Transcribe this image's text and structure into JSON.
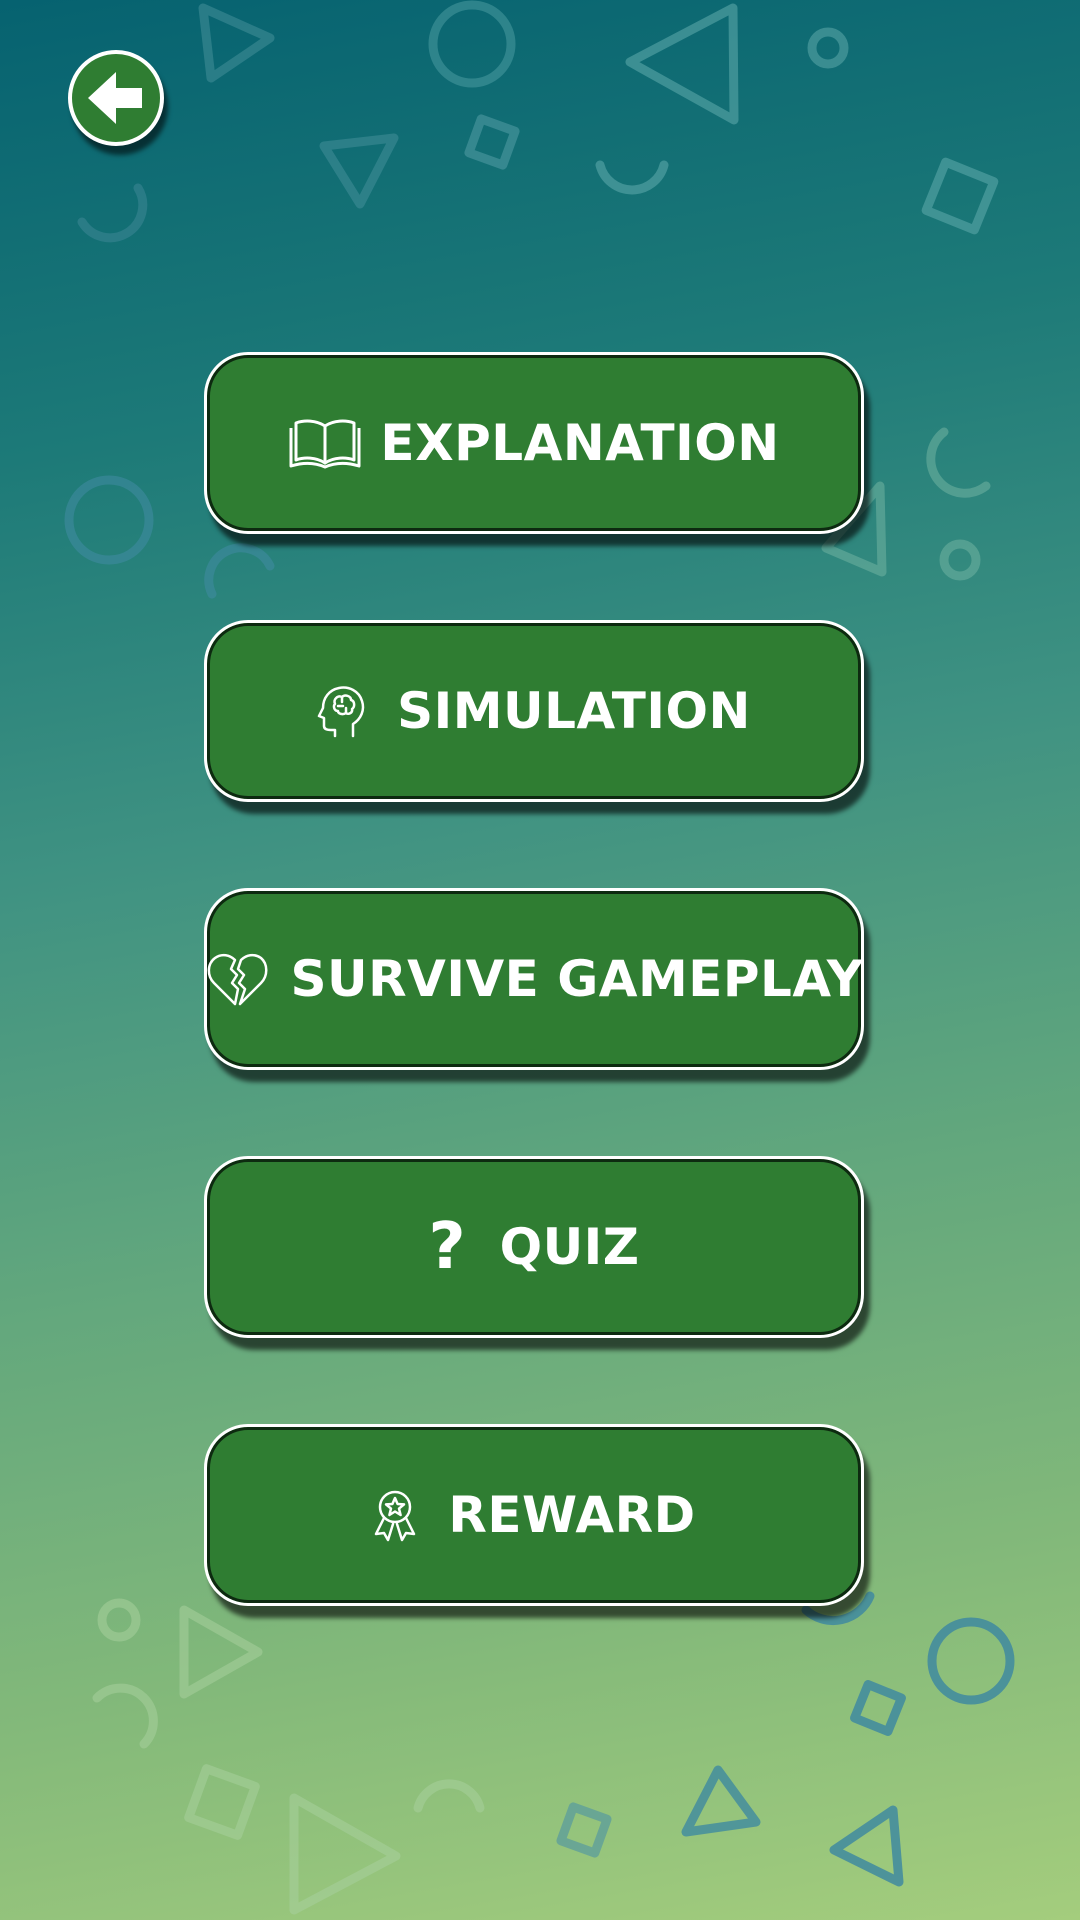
{
  "screen": "Learning menu",
  "back": {
    "icon": "arrow-left-icon"
  },
  "menu": [
    {
      "id": "explanation",
      "label": "EXPLANATION",
      "icon": "open-book-icon"
    },
    {
      "id": "simulation",
      "label": "SIMULATION",
      "icon": "brain-head-icon"
    },
    {
      "id": "survive",
      "label": "SURVIVE GAMEPLAY",
      "icon": "broken-heart-icon"
    },
    {
      "id": "quiz",
      "label": "QUIZ",
      "icon": "question-mark-icon"
    },
    {
      "id": "reward",
      "label": "REWARD",
      "icon": "award-ribbon-icon"
    }
  ],
  "colors": {
    "button_fill": "#2f7d32",
    "button_border": "#ffffff",
    "text": "#ffffff",
    "background_top": "#066270",
    "background_bottom": "#a4cd7d"
  }
}
